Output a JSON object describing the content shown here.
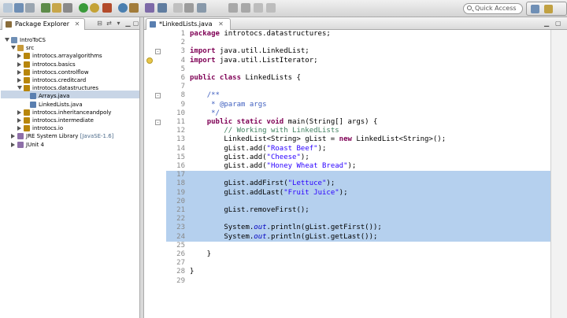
{
  "toolbar": {
    "quick_access_placeholder": "Quick Access"
  },
  "package_explorer": {
    "title": "Package Explorer",
    "tree": [
      {
        "label": "IntroToCS",
        "level": 0,
        "twisty": "open",
        "icon": "project-icon"
      },
      {
        "label": "src",
        "level": 1,
        "twisty": "open",
        "icon": "source-folder-icon"
      },
      {
        "label": "introtocs.arrayalgorithms",
        "level": 2,
        "twisty": "closed",
        "icon": "package-icon"
      },
      {
        "label": "introtocs.basics",
        "level": 2,
        "twisty": "closed",
        "icon": "package-icon"
      },
      {
        "label": "introtocs.controlflow",
        "level": 2,
        "twisty": "closed",
        "icon": "package-icon"
      },
      {
        "label": "introtocs.creditcard",
        "level": 2,
        "twisty": "closed",
        "icon": "package-icon"
      },
      {
        "label": "introtocs.datastructures",
        "level": 2,
        "twisty": "open",
        "icon": "package-icon"
      },
      {
        "label": "Arrays.java",
        "level": 3,
        "twisty": "closed",
        "icon": "java-file-icon"
      },
      {
        "label": "LinkedLists.java",
        "level": 3,
        "twisty": "closed",
        "icon": "java-file-icon",
        "selected": true
      },
      {
        "label": "introtocs.inheritanceandpoly",
        "level": 2,
        "twisty": "closed",
        "icon": "package-icon"
      },
      {
        "label": "introtocs.intermediate",
        "level": 2,
        "twisty": "closed",
        "icon": "package-icon"
      },
      {
        "label": "introtocs.io",
        "level": 2,
        "twisty": "closed",
        "icon": "package-icon"
      },
      {
        "label": "JRE System Library",
        "accent": " [JavaSE-1.6]",
        "level": 1,
        "twisty": "closed",
        "icon": "library-icon"
      },
      {
        "label": "JUnit 4",
        "level": 1,
        "twisty": "closed",
        "icon": "library-icon"
      }
    ]
  },
  "editor": {
    "tab_label": "*LinkedLists.java",
    "lines": [
      {
        "n": "1",
        "html": "<span class='kw'>package</span> introtocs.datastructures;"
      },
      {
        "n": "2",
        "html": ""
      },
      {
        "n": "3",
        "html": "<span class='kw'>import</span> java.util.LinkedList;",
        "fold": "-"
      },
      {
        "n": "4",
        "html": "<span class='kw'>import</span> java.util.ListIterator;",
        "marker": true
      },
      {
        "n": "5",
        "html": ""
      },
      {
        "n": "6",
        "html": "<span class='kw'>public class</span> LinkedLists {"
      },
      {
        "n": "7",
        "html": ""
      },
      {
        "n": "8",
        "html": "    <span class='jd'>/**</span>",
        "fold": "-"
      },
      {
        "n": "9",
        "html": "    <span class='jd'> * @param args</span>"
      },
      {
        "n": "10",
        "html": "    <span class='jd'> */</span>"
      },
      {
        "n": "11",
        "html": "    <span class='kw'>public static void</span> main(String[] args) {",
        "fold": "-"
      },
      {
        "n": "12",
        "html": "        <span class='cm'>// Working with LinkedLists</span>"
      },
      {
        "n": "13",
        "html": "        LinkedList&lt;String&gt; gList = <span class='kw'>new</span> LinkedList&lt;String&gt;();"
      },
      {
        "n": "14",
        "html": "        gList.add(<span class='st'>\"Roast Beef\"</span>);"
      },
      {
        "n": "15",
        "html": "        gList.add(<span class='st'>\"Cheese\"</span>);"
      },
      {
        "n": "16",
        "html": "        gList.add(<span class='st'>\"Honey Wheat Bread\"</span>);"
      },
      {
        "n": "17",
        "html": "",
        "hl": true
      },
      {
        "n": "18",
        "html": "        gList.addFirst(<span class='st'>\"Lettuce\"</span>);",
        "hl": true
      },
      {
        "n": "19",
        "html": "        gList.addLast(<span class='st'>\"Fruit Juice\"</span>);",
        "hl": true
      },
      {
        "n": "20",
        "html": "",
        "hl": true
      },
      {
        "n": "21",
        "html": "        gList.removeFirst();",
        "hl": true
      },
      {
        "n": "22",
        "html": "",
        "hl": true
      },
      {
        "n": "23",
        "html": "        System.<span class='it'>out</span>.println(gList.getFirst());",
        "hl": true
      },
      {
        "n": "24",
        "html": "        System.<span class='it'>out</span>.println(gList.getLast());",
        "hl": true
      },
      {
        "n": "25",
        "html": ""
      },
      {
        "n": "26",
        "html": "    }"
      },
      {
        "n": "27",
        "html": ""
      },
      {
        "n": "28",
        "html": "}"
      },
      {
        "n": "29",
        "html": ""
      }
    ]
  },
  "colors": {
    "selection": "#b5d0ee",
    "keyword": "#7f0055",
    "string": "#2a00ff",
    "comment": "#3f7f5f",
    "javadoc": "#3f5fbf"
  }
}
